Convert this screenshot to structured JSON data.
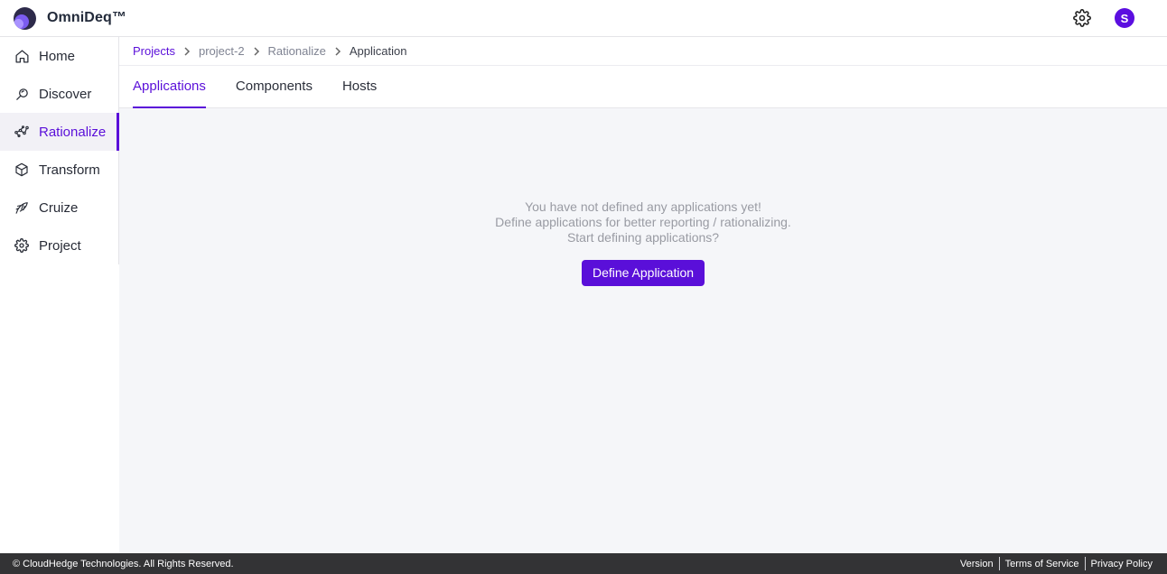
{
  "app": {
    "title": "OmniDeq™",
    "avatar_initial": "S",
    "accent_color": "#5a0fd9"
  },
  "sidebar": {
    "items": [
      {
        "label": "Home",
        "icon": "home-icon",
        "active": false
      },
      {
        "label": "Discover",
        "icon": "magnifier-icon",
        "active": false
      },
      {
        "label": "Rationalize",
        "icon": "rationalize-icon",
        "active": true
      },
      {
        "label": "Transform",
        "icon": "cube-icon",
        "active": false
      },
      {
        "label": "Cruize",
        "icon": "cruize-icon",
        "active": false
      },
      {
        "label": "Project",
        "icon": "gear-icon",
        "active": false
      }
    ]
  },
  "breadcrumb": [
    "Projects",
    "project-2",
    "Rationalize",
    "Application"
  ],
  "tabs": [
    {
      "label": "Applications",
      "active": true
    },
    {
      "label": "Components",
      "active": false
    },
    {
      "label": "Hosts",
      "active": false
    }
  ],
  "empty_state": {
    "line1": "You have not defined any applications yet!",
    "line2": "Define applications for better reporting / rationalizing.",
    "line3": "Start defining applications?",
    "button": "Define Application"
  },
  "footer": {
    "copyright": "© CloudHedge Technologies. All Rights Reserved.",
    "links": [
      "Version",
      "Terms of Service",
      "Privacy Policy"
    ]
  }
}
